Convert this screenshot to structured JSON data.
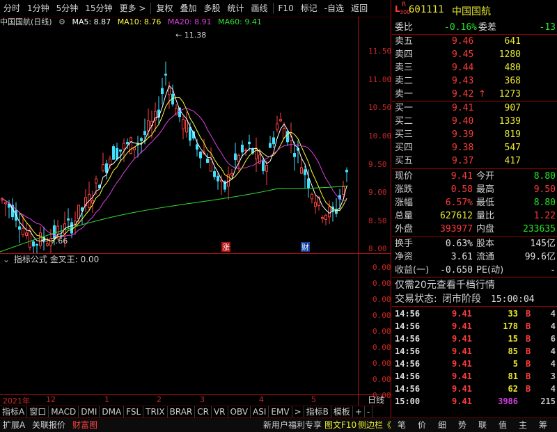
{
  "toolbar": {
    "items": [
      "分时",
      "1分钟",
      "5分钟",
      "15分钟",
      "更多 >",
      "复权",
      "叠加",
      "多股",
      "统计",
      "画线",
      "F10",
      "标记",
      "-自选",
      "返回"
    ]
  },
  "chart": {
    "stock_name": "中国国航(日线)",
    "ma5": "MA5: 8.87",
    "ma10": "MA10: 8.76",
    "ma20": "MA20: 8.91",
    "ma60": "MA60: 9.41",
    "high_label": "11.38",
    "low_label": "7.66",
    "y_ticks": [
      "11.50",
      "11.00",
      "10.50",
      "10.00",
      "9.50",
      "9.00",
      "8.50",
      "8.00"
    ],
    "marker_zhang": "涨",
    "marker_cai": "财",
    "colors": {
      "ma5": "#ffffff",
      "ma10": "#ffff40",
      "ma20": "#e040e0",
      "ma60": "#30e030",
      "up": "#ff4040",
      "down": "#40e0ff",
      "frame": "#b01010"
    }
  },
  "indicator": {
    "title": "指标公式 金叉王: 0.00",
    "y_ticks": [
      "0.00",
      "0.00",
      "0.00",
      "0.00",
      "0.00",
      "0.00",
      "0.00",
      "0.00",
      "0.00"
    ]
  },
  "x_axis": {
    "labels": [
      "2021年",
      "12",
      "1",
      "2",
      "3",
      "4",
      "5"
    ],
    "period": "日线"
  },
  "tabs": [
    "指标A",
    "窗口",
    "MACD",
    "DMI",
    "DMA",
    "FSL",
    "TRIX",
    "BRAR",
    "CR",
    "VR",
    "OBV",
    "ASI",
    "EMV",
    ">",
    "指标B",
    "模板",
    "+",
    "-"
  ],
  "bottom": {
    "left": [
      "扩展A",
      "关联报价",
      "财富图"
    ],
    "promo": "新用户福利专享",
    "f10": "图文F10",
    "sidebar": "侧边栏《",
    "right": [
      "笔",
      "价",
      "细",
      "势",
      "联",
      "值",
      "主",
      "筹"
    ]
  },
  "quote": {
    "code": "601111",
    "name": "中国国航",
    "badge_top": "R",
    "badge_bot": "300",
    "badge_l": "L",
    "weibi_label": "委比",
    "weibi": "-0.16%",
    "weicha_label": "委差",
    "weicha": "-13",
    "asks": [
      {
        "label": "卖五",
        "price": "9.46",
        "vol": "641"
      },
      {
        "label": "卖四",
        "price": "9.45",
        "vol": "1280"
      },
      {
        "label": "卖三",
        "price": "9.44",
        "vol": "480"
      },
      {
        "label": "卖二",
        "price": "9.43",
        "vol": "368"
      },
      {
        "label": "卖一",
        "price": "9.42",
        "vol": "1273",
        "arrow": "↑"
      }
    ],
    "bids": [
      {
        "label": "买一",
        "price": "9.41",
        "vol": "907"
      },
      {
        "label": "买二",
        "price": "9.40",
        "vol": "1339"
      },
      {
        "label": "买三",
        "price": "9.39",
        "vol": "819"
      },
      {
        "label": "买四",
        "price": "9.38",
        "vol": "547"
      },
      {
        "label": "买五",
        "price": "9.37",
        "vol": "417"
      }
    ],
    "stats": [
      {
        "l1": "现价",
        "v1": "9.41",
        "l2": "今开",
        "v2": "8.80"
      },
      {
        "l1": "涨跌",
        "v1": "0.58",
        "l2": "最高",
        "v2": "9.50"
      },
      {
        "l1": "涨幅",
        "v1": "6.57%",
        "l2": "最低",
        "v2": "8.80"
      },
      {
        "l1": "总量",
        "v1": "627612",
        "l2": "量比",
        "v2": "1.22"
      },
      {
        "l1": "外盘",
        "v1": "393977",
        "l2": "内盘",
        "v2": "233635"
      }
    ],
    "stats2": [
      {
        "l1": "换手",
        "v1": "0.63%",
        "l2": "股本",
        "v2": "145亿"
      },
      {
        "l1": "净资",
        "v1": "3.61",
        "l2": "流通",
        "v2": "99.6亿"
      },
      {
        "l1": "收益(一)",
        "v1": "-0.650",
        "l2": "PE(动)",
        "v2": "-"
      }
    ],
    "promo": "仅需20元查看千档行情",
    "status_label": "交易状态:",
    "status": "闭市阶段",
    "status_time": "15:00:04",
    "ticks": [
      {
        "t": "14:56",
        "p": "9.41",
        "v": "33",
        "bs": "B",
        "n": "4"
      },
      {
        "t": "14:56",
        "p": "9.41",
        "v": "178",
        "bs": "B",
        "n": "4"
      },
      {
        "t": "14:56",
        "p": "9.41",
        "v": "15",
        "bs": "B",
        "n": "6"
      },
      {
        "t": "14:56",
        "p": "9.41",
        "v": "85",
        "bs": "B",
        "n": "4"
      },
      {
        "t": "14:56",
        "p": "9.41",
        "v": "5",
        "bs": "B",
        "n": "4"
      },
      {
        "t": "14:56",
        "p": "9.41",
        "v": "81",
        "bs": "B",
        "n": "3"
      },
      {
        "t": "14:56",
        "p": "9.41",
        "v": "62",
        "bs": "B",
        "n": "4"
      },
      {
        "t": "15:00",
        "p": "9.41",
        "v": "3986",
        "bs": "",
        "n": "215"
      }
    ]
  }
}
